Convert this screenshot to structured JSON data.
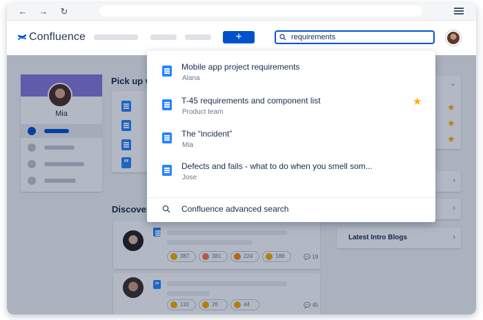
{
  "browser": {
    "back_icon": "arrow-left-icon",
    "forward_icon": "arrow-right-icon",
    "reload_icon": "reload-icon",
    "menu_icon": "hamburger-menu-icon"
  },
  "header": {
    "app_name": "Confluence",
    "create_label": "+",
    "search": {
      "value": "requirements",
      "icon": "search-icon"
    }
  },
  "profile": {
    "name": "Mia"
  },
  "main": {
    "pickup_title": "Pick up w",
    "discover_title": "Discover"
  },
  "feed": [
    {
      "reactions": [
        "387",
        "381",
        "224",
        "188"
      ],
      "comments": "19"
    },
    {
      "reactions": [
        "110",
        "26",
        "44"
      ],
      "comments": "45"
    }
  ],
  "right_panel": {
    "latest_blogs": "Latest Intro Blogs"
  },
  "search_results": [
    {
      "title": "Mobile app project requirements",
      "subtitle": "Alana",
      "starred": false
    },
    {
      "title": "T-45 requirements and component list",
      "subtitle": "Product team",
      "starred": true
    },
    {
      "title": "The “incident”",
      "subtitle": "Mia",
      "starred": false
    },
    {
      "title": "Defects and fails - what to do when you smell som...",
      "subtitle": "Jose",
      "starred": false
    }
  ],
  "advanced_search": "Confluence advanced search",
  "colors": {
    "brand": "#0052cc",
    "accent": "#2684ff",
    "star": "#ffab00",
    "profile_header": "#8777d9"
  }
}
